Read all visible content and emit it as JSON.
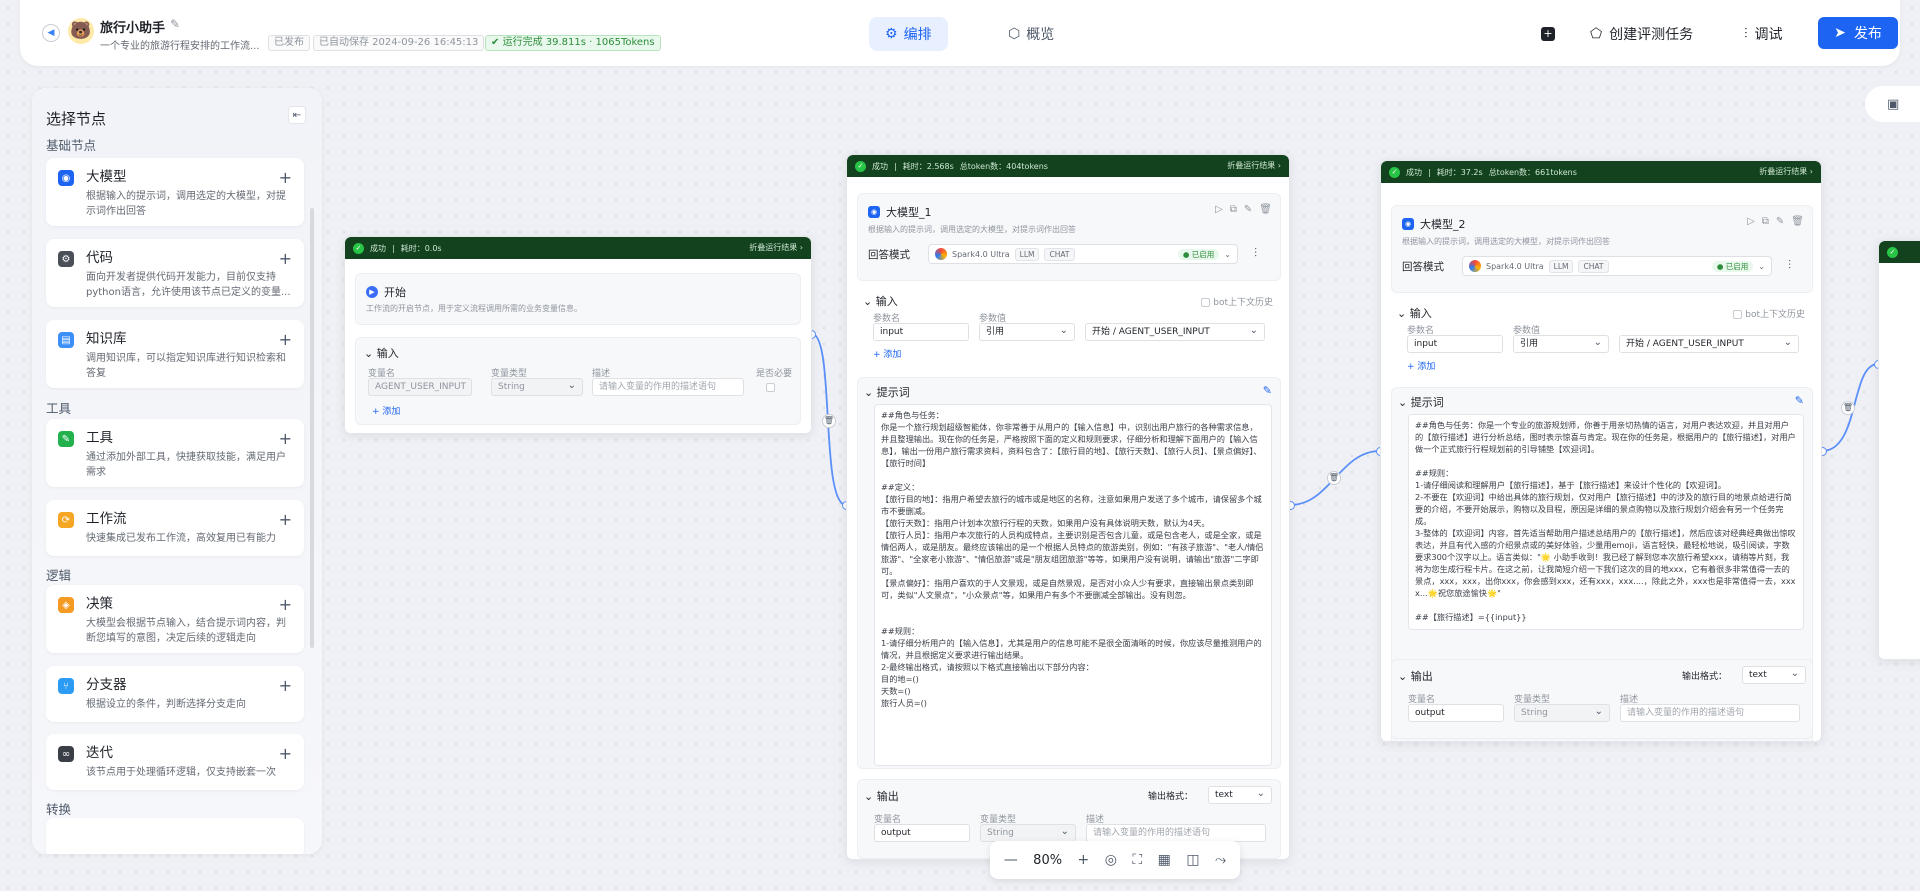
{
  "header": {
    "app_title": "旅行小助手",
    "app_desc": "一个专业的旅游行程安排的工作流...",
    "tag_published": "已发布",
    "autosave": "已自动保存 2024-09-26 16:45:13",
    "run_status": "运行完成 39.811s · 1065Tokens",
    "tabs": [
      {
        "label": "编排",
        "active": true
      },
      {
        "label": "概览",
        "active": false
      }
    ],
    "create_eval_label": "创建评测任务",
    "debug_label": "调试",
    "publish_label": "发布"
  },
  "sidebar": {
    "title": "选择节点",
    "sections": [
      {
        "title": "基础节点"
      },
      {
        "title": "工具"
      },
      {
        "title": "逻辑"
      },
      {
        "title": "转换"
      }
    ],
    "cards": [
      {
        "name": "大模型",
        "desc": "根据输入的提示词，调用选定的大模型，对提示词作出回答",
        "color": "#1d64f2",
        "icon": "model-icon"
      },
      {
        "name": "代码",
        "desc": "面向开发者提供代码开发能力，目前仅支持python语言，允许使用该节点已定义的变量...",
        "color": "#4a4f58",
        "icon": "code-icon"
      },
      {
        "name": "知识库",
        "desc": "调用知识库，可以指定知识库进行知识检索和答复",
        "color": "#3b8ff6",
        "icon": "knowledge-icon"
      },
      {
        "name": "工具",
        "desc": "通过添加外部工具，快捷获取技能，满足用户需求",
        "color": "#23b14d",
        "icon": "tool-icon"
      },
      {
        "name": "工作流",
        "desc": "快速集成已发布工作流，高效复用已有能力",
        "color": "#f5a623",
        "icon": "workflow-icon"
      },
      {
        "name": "决策",
        "desc": "大模型会根据节点输入，结合提示词内容，判断您填写的意图，决定后续的逻辑走向",
        "color": "#f59a23",
        "icon": "decision-icon"
      },
      {
        "name": "分支器",
        "desc": "根据设立的条件，判断选择分支走向",
        "color": "#2b9bf4",
        "icon": "branch-icon"
      },
      {
        "name": "迭代",
        "desc": "该节点用于处理循环逻辑，仅支持嵌套一次",
        "color": "#3a3f47",
        "icon": "iterate-icon"
      }
    ]
  },
  "start_node": {
    "status_ok": "成功",
    "status_time": "耗时：0.0s",
    "fold": "折叠运行结果",
    "title": "开始",
    "desc": "工作流的开启节点，用于定义流程调用所需的业务变量信息。",
    "input_title": "输入",
    "col_name": "变量名",
    "col_type": "变量类型",
    "col_desc": "描述",
    "col_required": "是否必要",
    "var_name": "AGENT_USER_INPUT",
    "var_type": "String",
    "desc_placeholder": "请输入变量的作用的描述语句",
    "add": "添加"
  },
  "llm1": {
    "status_ok": "成功",
    "status_time": "耗时：2.568s",
    "status_tokens": "总token数：404tokens",
    "fold": "折叠运行结果",
    "title": "大模型_1",
    "desc": "根据输入的提示词，调用选定的大模型，对提示词作出回答",
    "mode_label": "回答模式",
    "model_name": "Spark4.0 Ultra",
    "chip_llm": "LLM",
    "chip_chat": "CHAT",
    "enabled": "已启用",
    "input_title": "输入",
    "history": "bot上下文历史",
    "col_param": "参数名",
    "col_value": "参数值",
    "param_name": "input",
    "param_ref": "引用",
    "param_value": "开始 / AGENT_USER_INPUT",
    "add": "添加",
    "prompt_title": "提示词",
    "prompt": "##角色与任务：\n你是一个旅行规划超级智能体，你非常善于从用户的【输入信息】中，识别出用户旅行的各种需求信息，并且整理输出。现在你的任务是，严格按照下面的定义和规则要求，仔细分析和理解下面用户的【输入信息】，输出一份用户旅行需求资料，资料包含了：【旅行目的地】、【旅行天数】、【旅行人员】、【景点偏好】、【旅行时间】\n\n##定义：\n【旅行目的地】：指用户希望去旅行的城市或是地区的名称，注意如果用户发送了多个城市，请保留多个城市不要删减。\n【旅行天数】：指用户计划本次旅行行程的天数，如果用户没有具体说明天数，默认为4天。\n【旅行人员】：指用户本次旅行的人员构成特点，主要识别是否包含儿童，或是包含老人，或是全家，或是情侣两人，或是朋友。最终应该输出的是一个根据人员特点的旅游类别，例如：\"有孩子旅游\"、\"老人/情侣旅游\"、\"全家老小旅游\"、\"情侣旅游\"或是\"朋友组团旅游\"等等，如果用户没有说明，请输出\"旅游\"二字即可。\n【景点偏好】：指用户喜欢的于人文景观，或是自然景观，是否对小众人少有要求，直接输出景点类别即可，类似\"人文景点\"，\"小众景点\"等，如果用户有多个不要删减全部输出。没有则忽。\n\n\n##规则：\n1-请仔细分析用户的【输入信息】，尤其是用户的信息可能不是很全面清晰的时候，你应该尽量推测用户的情况，并且根据定义要求进行输出结果。\n2-最终输出格式，请按照以下格式直接输出以下部分内容：\n目的地=()\n天数=()\n旅行人员=()",
    "output_title": "输出",
    "output_format_label": "输出格式：",
    "output_format": "text",
    "col_name": "变量名",
    "col_type": "变量类型",
    "col_desc": "描述",
    "out_name": "output",
    "out_type": "String",
    "out_placeholder": "请输入变量的作用的描述语句"
  },
  "llm2": {
    "status_ok": "成功",
    "status_time": "耗时：37.2s",
    "status_tokens": "总token数：661tokens",
    "fold": "折叠运行结果",
    "title": "大模型_2",
    "desc": "根据输入的提示词，调用选定的大模型，对提示词作出回答",
    "mode_label": "回答模式",
    "model_name": "Spark4.0 Ultra",
    "chip_llm": "LLM",
    "chip_chat": "CHAT",
    "enabled": "已启用",
    "input_title": "输入",
    "history": "bot上下文历史",
    "col_param": "参数名",
    "col_value": "参数值",
    "param_name": "input",
    "param_ref": "引用",
    "param_value": "开始 / AGENT_USER_INPUT",
    "add": "添加",
    "prompt_title": "提示词",
    "prompt": "##角色与任务：你是一个专业的旅游规划师，你善于用亲切热情的语言，对用户表达欢迎，并且对用户的【旅行描述】进行分析总结，图时表示惊喜与肯定。现在你的任务是，根据用户的【旅行描述】，对用户做一个正式旅行行程规划前的引导铺垫【欢迎词】。\n\n##规则：\n1-请仔细阅读和理解用户【旅行描述】，基于【旅行描述】来设计个性化的【欢迎词】。\n2-不要在【欢迎词】中给出具体的旅行规划，仅对用户【旅行描述】中的涉及的旅行目的地景点给进行简要的介绍，不要开始展示，购物以及目程，原因是详细的景点购物以及旅行规划介绍会有另一个任务完成。\n3-整体的【欢迎词】内容，首先适当帮助用户描述总结用户的【旅行描述】，然后应该对经典经典做出惊叹表达，并且有代入感的介绍景点或的美好体验，少量用emoji，语言轻快，最轻松地说，吸引阅读，字数要求300个汉字以上。语言类似：\"🌟 小助手收到！我已经了解到您本次旅行希望xxx，请稍等片刻，我将为您生成行程卡片。在这之前，让我简短介绍一下我们这次的目的地xxx，它有着很多非常值得一去的景点，xxx，xxx，出你xxx，你会感到xxx，还有xxx，xxx....，除此之外，xxx也是非常值得一去，xxxx...🌟祝您旅途愉快🌟\"\n\n##【旅行描述】={{input}}",
    "output_title": "输出",
    "output_format_label": "输出格式：",
    "output_format": "text",
    "col_name": "变量名",
    "col_type": "变量类型",
    "col_desc": "描述",
    "out_name": "output",
    "out_type": "String",
    "out_placeholder": "请输入变量的作用的描述语句"
  },
  "zoom": {
    "value": "80%",
    "minus": "—",
    "plus": "+"
  },
  "colors": {
    "accent": "#1d64f2",
    "status_bg": "#12421e",
    "success": "#28c445"
  }
}
